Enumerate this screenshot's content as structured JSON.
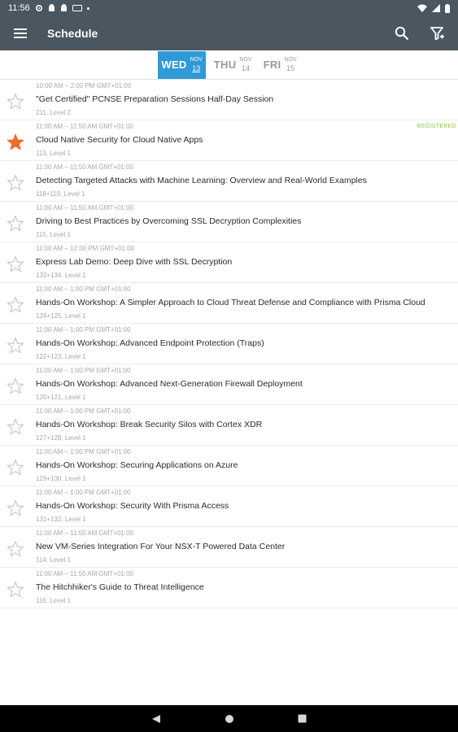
{
  "status_bar": {
    "time": "11:56",
    "icons": [
      "settings-icon",
      "android-icon",
      "android-icon",
      "nfc-icon",
      "dot-icon"
    ],
    "right_icons": [
      "wifi-icon",
      "signal-icon",
      "battery-icon"
    ]
  },
  "app_bar": {
    "title": "Schedule",
    "icons": [
      "menu-icon",
      "search-icon",
      "filter-icon"
    ]
  },
  "days": [
    {
      "name": "WED",
      "month": "NOV",
      "date": "13",
      "active": true
    },
    {
      "name": "THU",
      "month": "NOV",
      "date": "14",
      "active": false
    },
    {
      "name": "FRI",
      "month": "NOV",
      "date": "15",
      "active": false
    }
  ],
  "sessions": [
    {
      "time": "10:00 AM – 2:00 PM GMT+01:00",
      "title": "\"Get Certified\" PCNSE Preparation Sessions Half-Day Session",
      "room": "211, Level 2",
      "starred": false,
      "badge": ""
    },
    {
      "time": "11:00 AM – 11:50 AM GMT+01:00",
      "title": "Cloud Native Security for Cloud Native Apps",
      "room": "113, Level 1",
      "starred": true,
      "badge": "REGISTERED"
    },
    {
      "time": "11:00 AM – 11:50 AM GMT+01:00",
      "title": "Detecting Targeted Attacks with Machine Learning: Overview and Real-World Examples",
      "room": "118+119, Level 1",
      "starred": false,
      "badge": ""
    },
    {
      "time": "11:00 AM – 11:50 AM GMT+01:00",
      "title": "Driving to Best Practices by Overcoming SSL Decryption Complexities",
      "room": "115, Level 1",
      "starred": false,
      "badge": ""
    },
    {
      "time": "11:00 AM – 12:00 PM GMT+01:00",
      "title": "Express Lab Demo: Deep Dive with SSL Decryption",
      "room": "133+134, Level 1",
      "starred": false,
      "badge": ""
    },
    {
      "time": "11:00 AM – 1:00 PM GMT+01:00",
      "title": "Hands-On Workshop: A Simpler Approach to Cloud Threat Defense and Compliance with Prisma Cloud",
      "room": "124+125, Level 1",
      "starred": false,
      "badge": ""
    },
    {
      "time": "11:00 AM – 1:00 PM GMT+01:00",
      "title": "Hands-On Workshop: Advanced Endpoint Protection (Traps)",
      "room": "122+123, Level 1",
      "starred": false,
      "badge": ""
    },
    {
      "time": "11:00 AM – 1:00 PM GMT+01:00",
      "title": "Hands-On Workshop: Advanced Next-Generation Firewall Deployment",
      "room": "120+121, Level 1",
      "starred": false,
      "badge": ""
    },
    {
      "time": "11:00 AM – 1:00 PM GMT+01:00",
      "title": "Hands-On Workshop: Break Security Silos with Cortex XDR",
      "room": "127+128, Level 1",
      "starred": false,
      "badge": ""
    },
    {
      "time": "11:00 AM – 1:00 PM GMT+01:00",
      "title": "Hands-On Workshop: Securing Applications on Azure",
      "room": "129+130, Level 1",
      "starred": false,
      "badge": ""
    },
    {
      "time": "11:00 AM – 1:00 PM GMT+01:00",
      "title": "Hands-On Workshop: Security With Prisma Access",
      "room": "131+132, Level 1",
      "starred": false,
      "badge": ""
    },
    {
      "time": "11:00 AM – 11:50 AM GMT+01:00",
      "title": "New VM-Series Integration For Your NSX-T Powered Data Center",
      "room": "114, Level 1",
      "starred": false,
      "badge": ""
    },
    {
      "time": "11:00 AM – 11:50 AM GMT+01:00",
      "title": "The Hitchhiker's Guide to Threat Intelligence",
      "room": "116, Level 1",
      "starred": false,
      "badge": ""
    }
  ],
  "nav_bar": {
    "icons": [
      "back-icon",
      "home-icon",
      "recents-icon"
    ]
  },
  "colors": {
    "app_bar": "#4a5660",
    "active_day": "#2e9ad7",
    "star_on": "#f26b2a",
    "star_off": "#c9c9c9",
    "registered": "#8bc34a"
  }
}
